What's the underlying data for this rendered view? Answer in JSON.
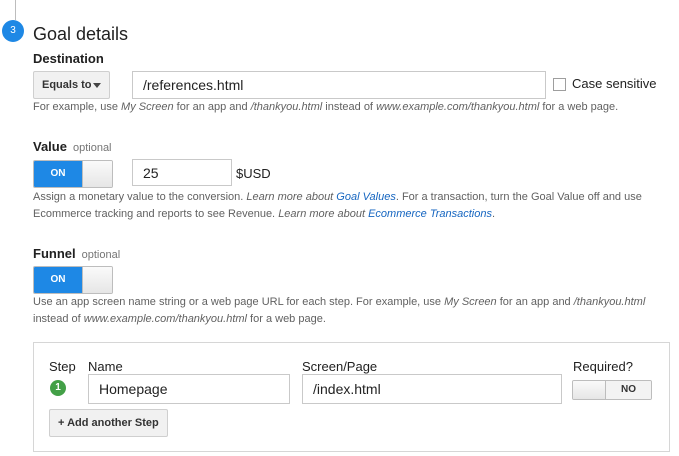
{
  "step": {
    "number": "3",
    "title": "Goal details"
  },
  "destination": {
    "label": "Destination",
    "match_type": "Equals to",
    "value": "/references.html",
    "case_sensitive_label": "Case sensitive",
    "case_sensitive_checked": false,
    "help": {
      "p1": "For example, use ",
      "ex1": "My Screen",
      "p2": " for an app and ",
      "ex2": "/thankyou.html",
      "p3": " instead of ",
      "ex3": "www.example.com/thankyou.html",
      "p4": " for a web page."
    }
  },
  "value_section": {
    "label": "Value",
    "optional": "optional",
    "toggle_state": "ON",
    "amount": "25",
    "currency": "$USD",
    "help": {
      "p1": "Assign a monetary value to the conversion. ",
      "p2": "Learn more about ",
      "link1": "Goal Values",
      "p3": ". For a transaction, turn the Goal Value off and use",
      "p4": "Ecommerce tracking and reports to see Revenue. ",
      "p5": "Learn more about ",
      "link2": "Ecommerce Transactions",
      "p6": "."
    }
  },
  "funnel": {
    "label": "Funnel",
    "optional": "optional",
    "toggle_state": "ON",
    "help": {
      "p1": "Use an app screen name string or a web page URL for each step. For example, use ",
      "ex1": "My Screen",
      "p2": " for an app and ",
      "ex2": "/thankyou.html",
      "p3": "instead of ",
      "ex3": "www.example.com/thankyou.html",
      "p4": " for a web page."
    },
    "table": {
      "headers": {
        "step": "Step",
        "name": "Name",
        "screen": "Screen/Page",
        "required": "Required?"
      },
      "rows": [
        {
          "step": "1",
          "name": "Homepage",
          "screen": "/index.html",
          "required": "NO"
        }
      ],
      "add_button": "+ Add another Step"
    }
  },
  "colors": {
    "accent": "#1e88e5",
    "step_green": "#43a047",
    "link": "#1565c0"
  }
}
